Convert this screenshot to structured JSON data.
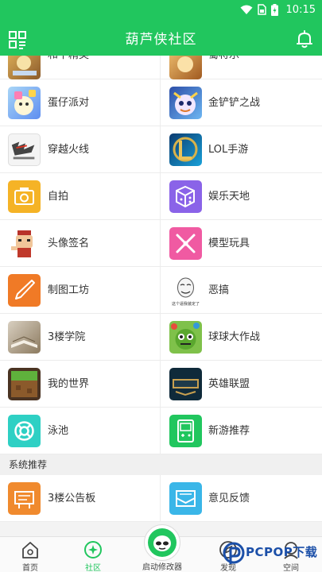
{
  "status_bar": {
    "time": "10:15"
  },
  "header": {
    "title": "葫芦侠社区"
  },
  "list_items": [
    {
      "label": "和平精英",
      "icon": "peace-elite-game-icon"
    },
    {
      "label": "蜀将乐",
      "icon": "game-icon"
    },
    {
      "label": "蛋仔派对",
      "icon": "eggy-party-game-icon"
    },
    {
      "label": "金铲铲之战",
      "icon": "golden-spatula-game-icon"
    },
    {
      "label": "穿越火线",
      "icon": "crossfire-game-icon"
    },
    {
      "label": "LOL手游",
      "icon": "lol-game-icon"
    },
    {
      "label": "自拍",
      "icon": "camera-icon"
    },
    {
      "label": "娱乐天地",
      "icon": "dice-icon"
    },
    {
      "label": "头像签名",
      "icon": "avatar-character-icon"
    },
    {
      "label": "模型玩具",
      "icon": "model-toy-icon"
    },
    {
      "label": "制图工坊",
      "icon": "pen-icon"
    },
    {
      "label": "恶搞",
      "icon": "meme-face-icon"
    },
    {
      "label": "3楼学院",
      "icon": "book-icon"
    },
    {
      "label": "球球大作战",
      "icon": "ball-battle-game-icon"
    },
    {
      "label": "我的世界",
      "icon": "minecraft-game-icon"
    },
    {
      "label": "英雄联盟",
      "icon": "league-of-legends-game-icon"
    },
    {
      "label": "泳池",
      "icon": "lifebuoy-icon"
    },
    {
      "label": "新游推荐",
      "icon": "new-game-device-icon"
    }
  ],
  "meme_caption": "这个逼我装定了",
  "section": {
    "title": "系统推荐"
  },
  "system_items": [
    {
      "label": "3楼公告板",
      "icon": "notice-board-icon"
    },
    {
      "label": "意见反馈",
      "icon": "feedback-mail-icon"
    }
  ],
  "bottom_nav": {
    "home": "首页",
    "community": "社区",
    "launcher": "启动修改器",
    "discover": "发现",
    "space": "空间"
  },
  "watermark": {
    "text": "PCPOP下载"
  },
  "colors": {
    "brand": "#21c65e"
  }
}
